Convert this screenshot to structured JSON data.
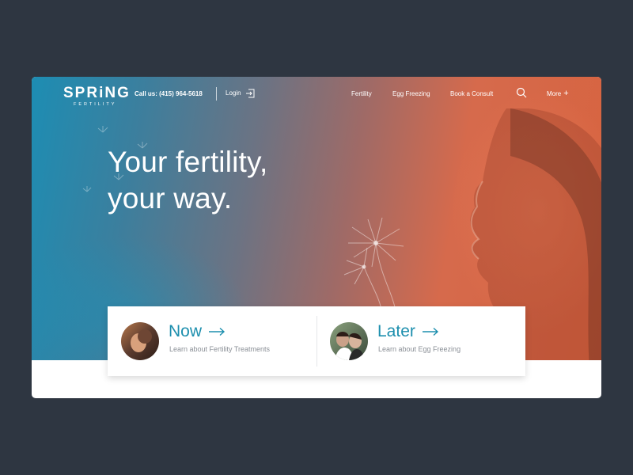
{
  "brand": {
    "name": "SPRiNG",
    "tagline": "FERTILITY"
  },
  "header": {
    "phone_label": "Call us: (415) 964-5618",
    "login_label": "Login",
    "nav": [
      "Fertility",
      "Egg Freezing",
      "Book a Consult"
    ],
    "more_label": "More"
  },
  "hero": {
    "headline_line1": "Your fertility,",
    "headline_line2": "your way."
  },
  "options": [
    {
      "title": "Now",
      "description": "Learn about Fertility Treatments"
    },
    {
      "title": "Later",
      "description": "Learn about Egg Freezing"
    }
  ],
  "colors": {
    "background": "#2e3641",
    "gradient_start": "#1d8db3",
    "gradient_end": "#d7633f",
    "accent": "#1d8fae"
  },
  "icons": [
    "login-icon",
    "search-icon",
    "plus-icon",
    "arrow-right-icon"
  ]
}
